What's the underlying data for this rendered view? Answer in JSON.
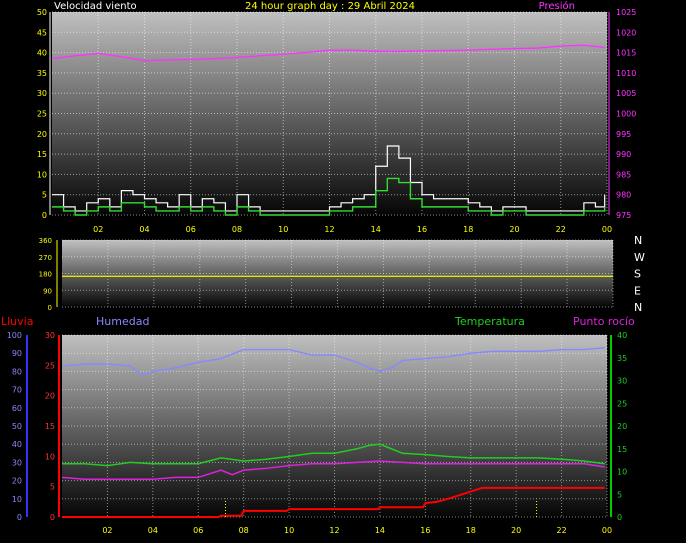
{
  "header": {
    "wind_title": "Velocidad viento",
    "graph_title": "24 hour graph day : 29 Abril 2024",
    "pressure_title": "Presión"
  },
  "legend": {
    "rain": "Lluvia",
    "humidity": "Humedad",
    "temperature": "Temperatura",
    "dewpoint": "Punto rocío"
  },
  "colors": {
    "background": "#000000",
    "tick_yellow": "#ffff00",
    "pressure": "#ff33ff",
    "gust": "#ffffff",
    "wind_avg": "#33dd33",
    "wind_dir": "#e6e600",
    "humidity": "#8888ff",
    "temperature": "#22cc22",
    "dewpoint": "#dd22dd",
    "rain": "#ff0000",
    "rain_axis": "#3333ff",
    "temp_axis": "#00cc00"
  },
  "chart_data": [
    {
      "id": "wind",
      "type": "line",
      "title": "24 hour graph day : 29 Abril 2024",
      "xlabel": "",
      "ylabel": "Velocidad viento",
      "x_ticks": [
        "02",
        "04",
        "06",
        "08",
        "10",
        "12",
        "14",
        "16",
        "18",
        "20",
        "22",
        "00"
      ],
      "xlim": [
        0,
        24
      ],
      "ylim": [
        0,
        50
      ],
      "y_ticks": [
        0,
        5,
        10,
        15,
        20,
        25,
        30,
        35,
        40,
        45,
        50
      ],
      "y2label": "Presión",
      "y2lim": [
        975,
        1025
      ],
      "y2_ticks": [
        975,
        980,
        985,
        990,
        995,
        1000,
        1005,
        1010,
        1015,
        1020,
        1025
      ],
      "grid": true,
      "series": [
        {
          "name": "Presión",
          "axis": "right",
          "x": [
            0,
            1,
            2,
            3,
            4,
            5,
            6,
            7,
            8,
            9,
            10,
            11,
            12,
            13,
            14,
            15,
            16,
            17,
            18,
            19,
            20,
            21,
            22,
            23,
            23.9
          ],
          "values": [
            1013.5,
            1014.2,
            1014.8,
            1014,
            1013,
            1013.2,
            1013.3,
            1013.5,
            1013.8,
            1014.2,
            1014.6,
            1015,
            1015.6,
            1015.6,
            1015.3,
            1015.3,
            1015.4,
            1015.5,
            1015.6,
            1015.8,
            1016,
            1016.1,
            1016.6,
            1016.8,
            1016.3
          ]
        },
        {
          "name": "Racha",
          "axis": "left",
          "x": [
            0,
            0.5,
            1,
            1.5,
            2,
            2.5,
            3,
            3.5,
            4,
            4.5,
            5,
            5.5,
            6,
            6.5,
            7,
            7.5,
            8,
            8.5,
            9,
            9.5,
            10,
            10.5,
            11,
            11.5,
            12,
            12.5,
            13,
            13.5,
            14,
            14.5,
            15,
            15.5,
            16,
            16.5,
            17,
            17.5,
            18,
            18.5,
            19,
            19.5,
            20,
            20.5,
            21,
            21.5,
            22,
            22.5,
            23,
            23.5,
            23.9
          ],
          "values": [
            5,
            2,
            1,
            3,
            4,
            2,
            6,
            5,
            4,
            3,
            2,
            5,
            2,
            4,
            3,
            1,
            5,
            2,
            1,
            1,
            1,
            1,
            1,
            1,
            2,
            3,
            4,
            5,
            12,
            17,
            14,
            8,
            5,
            4,
            4,
            4,
            3,
            2,
            1,
            2,
            2,
            1,
            1,
            1,
            1,
            1,
            3,
            2,
            5
          ]
        },
        {
          "name": "Viento medio",
          "axis": "left",
          "x": [
            0,
            0.5,
            1,
            1.5,
            2,
            2.5,
            3,
            3.5,
            4,
            4.5,
            5,
            5.5,
            6,
            6.5,
            7,
            7.5,
            8,
            8.5,
            9,
            9.5,
            10,
            10.5,
            11,
            11.5,
            12,
            12.5,
            13,
            13.5,
            14,
            14.5,
            15,
            15.5,
            16,
            16.5,
            17,
            17.5,
            18,
            18.5,
            19,
            19.5,
            20,
            20.5,
            21,
            21.5,
            22,
            22.5,
            23,
            23.5,
            23.9
          ],
          "values": [
            2,
            1,
            0,
            1,
            2,
            1,
            3,
            3,
            2,
            1,
            1,
            2,
            1,
            2,
            1,
            0,
            2,
            1,
            0,
            0,
            0,
            0,
            0,
            0,
            1,
            1,
            2,
            2,
            6,
            9,
            8,
            4,
            2,
            2,
            2,
            2,
            1,
            1,
            0,
            1,
            1,
            0,
            0,
            0,
            0,
            0,
            1,
            1,
            2
          ]
        }
      ]
    },
    {
      "id": "direction",
      "type": "line",
      "title": "",
      "xlabel": "",
      "ylabel": "",
      "xlim": [
        0,
        24
      ],
      "ylim": [
        0,
        360
      ],
      "y_ticks": [
        0,
        90,
        180,
        270,
        360
      ],
      "right_labels": [
        "N",
        "W",
        "S",
        "E",
        "N"
      ],
      "grid": true,
      "series": [
        {
          "name": "Dirección",
          "x": [
            0,
            24
          ],
          "values": [
            165,
            165
          ]
        }
      ]
    },
    {
      "id": "climate",
      "type": "line",
      "title": "",
      "xlabel": "",
      "ylabel": "",
      "x_ticks": [
        "02",
        "04",
        "06",
        "08",
        "10",
        "12",
        "14",
        "16",
        "18",
        "20",
        "22",
        "00"
      ],
      "xlim": [
        0,
        24
      ],
      "hum_ticks": [
        0,
        10,
        20,
        30,
        40,
        50,
        60,
        70,
        80,
        90,
        100
      ],
      "rain_ticks": [
        0,
        5,
        10,
        15,
        20,
        25,
        30
      ],
      "temp_ticks": [
        0,
        5,
        10,
        15,
        20,
        25,
        30,
        35,
        40
      ],
      "ylim_rain": [
        0,
        30
      ],
      "ylim_temp": [
        0,
        40
      ],
      "grid": true,
      "series": [
        {
          "name": "Humedad",
          "axis": "humidity",
          "x": [
            0,
            1,
            2,
            3,
            3.5,
            4,
            5,
            6,
            7,
            8,
            9,
            10,
            11,
            12,
            13,
            13.5,
            14,
            14.5,
            15,
            16,
            17,
            18,
            19,
            20,
            21,
            22,
            23,
            23.9
          ],
          "values": [
            83,
            84,
            84,
            83,
            78,
            80,
            82,
            85,
            87,
            92,
            92,
            92,
            89,
            89,
            85,
            82,
            80,
            82,
            86,
            87,
            88,
            90,
            91,
            91,
            91,
            92,
            92,
            93
          ]
        },
        {
          "name": "Temperatura",
          "axis": "temp",
          "x": [
            0,
            1,
            2,
            3,
            4,
            5,
            6,
            7,
            8,
            9,
            10,
            11,
            12,
            13,
            13.5,
            14,
            14.5,
            15,
            16,
            17,
            18,
            19,
            20,
            21,
            22,
            23,
            23.9
          ],
          "values": [
            11.7,
            11.7,
            11.3,
            12,
            11.7,
            11.7,
            11.7,
            13,
            12.3,
            12.7,
            13.3,
            14,
            14,
            15,
            15.7,
            16,
            15,
            14,
            13.7,
            13.3,
            13,
            13,
            13,
            13,
            12.7,
            12.3,
            11.7
          ]
        },
        {
          "name": "Punto rocío",
          "axis": "temp",
          "x": [
            0,
            1,
            2,
            3,
            4,
            5,
            6,
            7,
            7.5,
            8,
            9,
            10,
            11,
            12,
            13,
            14,
            15,
            16,
            17,
            18,
            19,
            20,
            21,
            22,
            23,
            23.9
          ],
          "values": [
            8.7,
            8.3,
            8.3,
            8.3,
            8.3,
            8.7,
            8.7,
            10.3,
            9.3,
            10.3,
            10.7,
            11.3,
            11.7,
            11.7,
            12,
            12.3,
            12,
            11.7,
            11.7,
            11.7,
            11.7,
            11.7,
            11.7,
            11.7,
            11.7,
            11
          ]
        },
        {
          "name": "Lluvia",
          "axis": "rain",
          "x": [
            0,
            6.9,
            7,
            7.9,
            8,
            9.9,
            10,
            13.9,
            14,
            15.9,
            16,
            16.5,
            17,
            17.5,
            18,
            18.5,
            19,
            23.9
          ],
          "values": [
            0,
            0,
            0.2,
            0.2,
            1,
            1,
            1.3,
            1.3,
            1.6,
            1.6,
            2.3,
            2.5,
            3,
            3.6,
            4.2,
            4.8,
            4.8,
            4.8
          ]
        },
        {
          "name": "Tasa lluvia",
          "axis": "rain",
          "type": "bar",
          "x": [
            7.2,
            20.9
          ],
          "values": [
            3,
            3
          ]
        }
      ]
    }
  ]
}
